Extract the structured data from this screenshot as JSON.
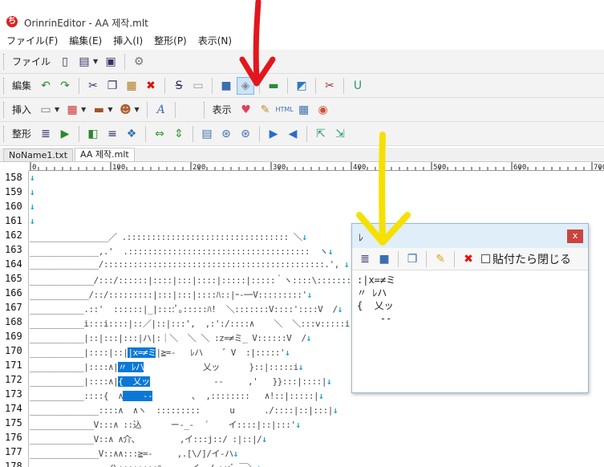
{
  "window": {
    "title": "OrinrinEditor - AA 제작.mlt",
    "app_icon": "orinrin-icon"
  },
  "menu": [
    "ファイル(F)",
    "編集(E)",
    "挿入(I)",
    "整形(P)",
    "表示(N)"
  ],
  "toolbars": {
    "file_label": "ファイル",
    "edit_label": "編集",
    "insert_label": "挿入",
    "view_label": "表示",
    "format_label": "整形"
  },
  "tabs": [
    {
      "label": "NoName1.txt",
      "active": false
    },
    {
      "label": "AA 제작.mlt",
      "active": true
    }
  ],
  "ruler": {
    "ticks": [
      "0",
      "100",
      "200",
      "300",
      "400",
      "500",
      "600",
      "700"
    ]
  },
  "editor": {
    "line_numbers": [
      "158",
      "159",
      "160",
      "161",
      "162",
      "163",
      "164",
      "165",
      "166",
      "167",
      "168",
      "169",
      "170",
      "171",
      "172",
      "173",
      "174",
      "175",
      "176",
      "177",
      "178"
    ],
    "lines": [
      {
        "pre": "",
        "sel": "",
        "post": ""
      },
      {
        "pre": "",
        "sel": "",
        "post": ""
      },
      {
        "pre": "",
        "sel": "",
        "post": ""
      },
      {
        "pre": "",
        "sel": "",
        "post": ""
      },
      {
        "pre": "________________／ .::::::::::::::::::::::::::::::::: ＼",
        "sel": "",
        "post": ""
      },
      {
        "pre": "______________,.'  .:::::::::::::::::::::::::::::::::::::  ヽ",
        "sel": "",
        "post": ""
      },
      {
        "pre": "______________/:::::::::::::::::::::::::::::::::::::::::::::.', ",
        "sel": "",
        "post": ""
      },
      {
        "pre": "_____________/:::/::::::|::::|:::|::::|:::::|:::::｀ヽ::::\\:::::::::::｡ﾟ",
        "sel": "",
        "post": ""
      },
      {
        "pre": "____________/::/:::::::::|:::|:::|::::ﾊ::|ｰ-─ｰV:::::::::'",
        "sel": "",
        "post": ""
      },
      {
        "pre": "___________.::'  ::::::|_|::::ﾟ｡:::::ﾊ!  ＼:::::::V::::'::::V  /",
        "sel": "",
        "post": ""
      },
      {
        "pre": "___________i:::i::::|::／|::|:::',  ,:':/::::∧    ＼  ＼:::v:::::i::V  /",
        "sel": "",
        "post": ""
      },
      {
        "pre": "___________|::|:::|:::|ハ|:｜＼  ＼ ＼ :z=≠ミ_ V::::::V  /",
        "sel": "",
        "post": ""
      },
      {
        "pre": "___________|::::|::|",
        "sel": "|x=≠ミ",
        "post": "|≧=-   ﾚハ    ゛V  :|:::::'"
      },
      {
        "pre": "___________|::::∧|",
        "sel": "〃 ﾚハ",
        "post": "            乂ッ      }::|:::::i"
      },
      {
        "pre": "___________|::::∧|",
        "sel": "{  乂ッ",
        "post": "             --     ,'   }}:::|::::|"
      },
      {
        "pre": "___________::::{  ∧",
        "sel": "    --",
        "post": "        ､  ,::::::::   ∧!::|:::::|"
      },
      {
        "pre": "______________::::∧  ∧ヽ  :::::::::      u      ./::::|::|:::|",
        "sel": "",
        "post": ""
      },
      {
        "pre": "_____________V:::∧ ::込      ー‐_-  ´    イ::::|::|:::'",
        "sel": "",
        "post": ""
      },
      {
        "pre": "_____________V::∧ ∧介､         ,イ:::j::/ :|::|/",
        "sel": "",
        "post": ""
      },
      {
        "pre": "______________V::∧∧:::≧=-     ,.[\\/]/イ-ハ",
        "sel": "",
        "post": ""
      },
      {
        "pre": "________________/\\::::::::ﾊ      イ  /ｰ:::ﾞ ￣＼",
        "sel": "",
        "post": ""
      }
    ]
  },
  "dialog": {
    "title": "ﾚ",
    "close": "x",
    "checkbox_label": "貼付たら閉じる",
    "content": ":|x=≠ミ\n〃 ﾚハ\n{  乂ッ\n    --"
  },
  "annotations": {
    "red_arrow_color": "#e3161d",
    "yellow_arrow_color": "#f5e000"
  }
}
